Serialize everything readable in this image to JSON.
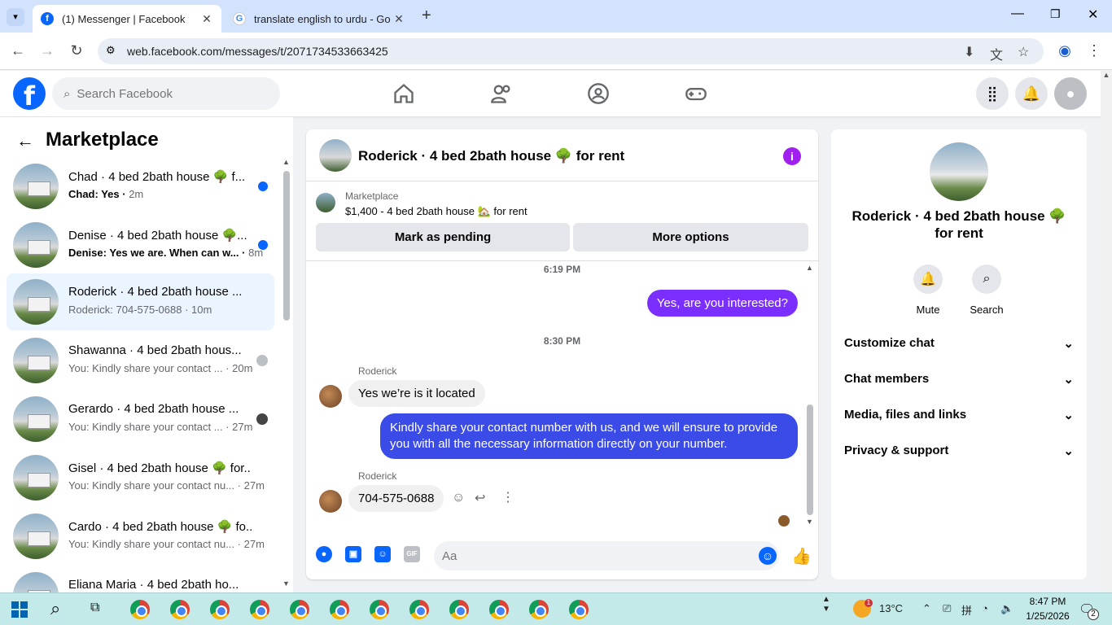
{
  "browser": {
    "tabs": [
      {
        "title": "(1) Messenger | Facebook",
        "active": true,
        "icon": "facebook-icon"
      },
      {
        "title": "translate english to urdu - Goo",
        "active": false,
        "icon": "google-icon"
      }
    ],
    "url": "web.facebook.com/messages/t/2071734533663425"
  },
  "fb": {
    "search_placeholder": "Search Facebook"
  },
  "sidebar": {
    "title": "Marketplace",
    "conversations": [
      {
        "name": "Chad · 4 bed 2bath house 🌳 f...",
        "preview": "Chad: Yes",
        "time": "2m",
        "unread": true,
        "status": "dot"
      },
      {
        "name": "Denise · 4 bed 2bath house 🌳...",
        "preview": "Denise: Yes we are. When can w...",
        "time": "8m",
        "unread": true,
        "status": "dot"
      },
      {
        "name": "Roderick · 4 bed 2bath house ...",
        "preview": "Roderick: 704-575-0688",
        "time": "10m",
        "unread": false,
        "selected": true,
        "status": ""
      },
      {
        "name": "Shawanna · 4 bed 2bath hous...",
        "preview": "You: Kindly share your contact ...",
        "time": "20m",
        "unread": false,
        "status": "seen"
      },
      {
        "name": "Gerardo · 4 bed 2bath house ...",
        "preview": "You: Kindly share your contact ...",
        "time": "27m",
        "unread": false,
        "status": "seen"
      },
      {
        "name": "Gisel · 4 bed 2bath house 🌳 for...",
        "preview": "You: Kindly share your contact nu...",
        "time": "27m",
        "unread": false,
        "status": ""
      },
      {
        "name": "Cardo · 4 bed 2bath house 🌳 fo...",
        "preview": "You: Kindly share your contact nu...",
        "time": "27m",
        "unread": false,
        "status": ""
      },
      {
        "name": "Eliana Maria · 4 bed 2bath ho...",
        "preview": "",
        "time": "",
        "unread": false,
        "status": ""
      }
    ]
  },
  "chat": {
    "title": "Roderick · 4 bed 2bath house 🌳 for rent",
    "listing_label": "Marketplace",
    "listing_desc": "$1,400 - 4 bed 2bath house 🏡 for rent",
    "pending_btn": "Mark as pending",
    "options_btn": "More options",
    "time1": "6:19 PM",
    "msg_out1": "Yes, are you interested?",
    "time2": "8:30 PM",
    "sender1": "Roderick",
    "msg_in1": "Yes we’re is it located",
    "msg_out2": "Kindly share your contact number with us, and we will ensure to provide you with all the necessary information directly on your number.",
    "sender2": "Roderick",
    "msg_in2": "704-575-0688",
    "composer_placeholder": "Aa"
  },
  "details": {
    "title": "Roderick · 4 bed 2bath house 🌳 for rent",
    "mute": "Mute",
    "search": "Search",
    "sections": [
      "Customize chat",
      "Chat members",
      "Media, files and links",
      "Privacy & support"
    ]
  },
  "taskbar": {
    "weather": "13°C",
    "weather_badge": "1",
    "time": "8:47 PM",
    "date": "1/25/2026",
    "notif_count": "2"
  },
  "colors": {
    "accent": "#0866ff",
    "outgoing": "#7b2fff",
    "outgoing_long": "#3a4be8",
    "info": "#a020f0"
  }
}
